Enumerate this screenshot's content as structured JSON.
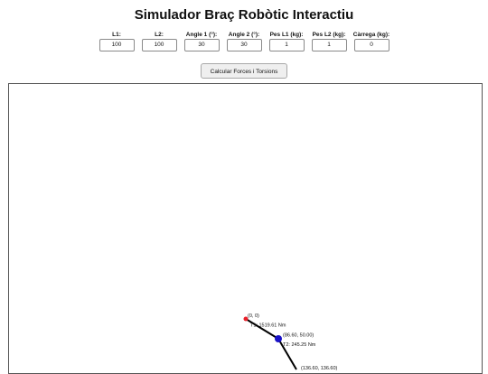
{
  "title": "Simulador Braç Robòtic Interactiu",
  "inputs": [
    {
      "label": "L1:",
      "value": "100"
    },
    {
      "label": "L2:",
      "value": "100"
    },
    {
      "label": "Angle 1 (°):",
      "value": "30"
    },
    {
      "label": "Angle 2 (°):",
      "value": "30"
    },
    {
      "label": "Pes L1 (kg):",
      "value": "1"
    },
    {
      "label": "Pes L2 (kg):",
      "value": "1"
    },
    {
      "label": "Càrrega (kg):",
      "value": "0"
    }
  ],
  "calc_button": "Calcular Forces i Torsions",
  "diagram": {
    "base_label": "(0, 0)",
    "torque1_label": "T1: 1519.61 Nm",
    "joint_label": "(86.60, 50.00)",
    "torque2_label": "T2: 245.25 Nm",
    "end_label": "(136.60, 136.60)",
    "colors": {
      "base": "#e8202a",
      "joint": "#1a12c8",
      "link": "#000000"
    }
  }
}
